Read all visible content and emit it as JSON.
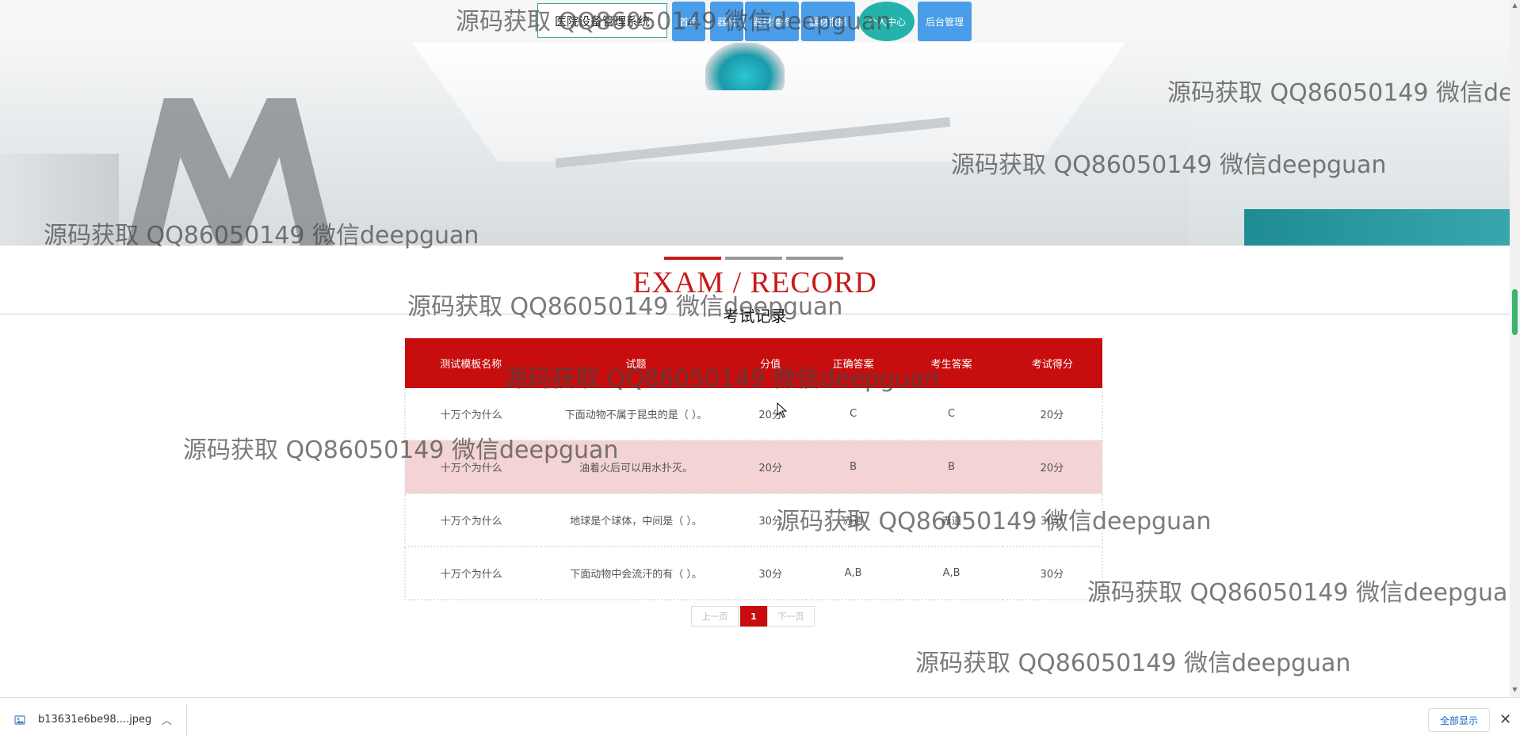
{
  "nav": {
    "site_title": "医院设备管理系统",
    "items": [
      "首页",
      "器材",
      "器材维修",
      "器材报损",
      "个人中心",
      "后台管理"
    ]
  },
  "section": {
    "title_en": "EXAM / RECORD",
    "title_cn": "考试记录"
  },
  "table": {
    "headers": [
      "测试模板名称",
      "试题",
      "分值",
      "正确答案",
      "考生答案",
      "考试得分"
    ],
    "rows": [
      [
        "十万个为什么",
        "下面动物不属于昆虫的是（ ）。",
        "20分",
        "C",
        "C",
        "20分"
      ],
      [
        "十万个为什么",
        "油着火后可以用水扑灭。",
        "20分",
        "B",
        "B",
        "20分"
      ],
      [
        "十万个为什么",
        "地球是个球体，中间是（ ）。",
        "30分",
        "赤道",
        "赤道",
        "30分"
      ],
      [
        "十万个为什么",
        "下面动物中会流汗的有（ ）。",
        "30分",
        "A,B",
        "A,B",
        "30分"
      ]
    ]
  },
  "pagination": {
    "prev": "上一页",
    "current": "1",
    "next": "下一页"
  },
  "watermark": "源码获取 QQ86050149 微信deepguan",
  "download_bar": {
    "file_name": "b13631e6be98....jpeg",
    "show_all": "全部显示"
  },
  "colors": {
    "accent_red": "#c70d0d",
    "nav_blue": "#4a9de8",
    "nav_teal": "#23b3ac",
    "row_highlight": "#f3d3d3"
  }
}
